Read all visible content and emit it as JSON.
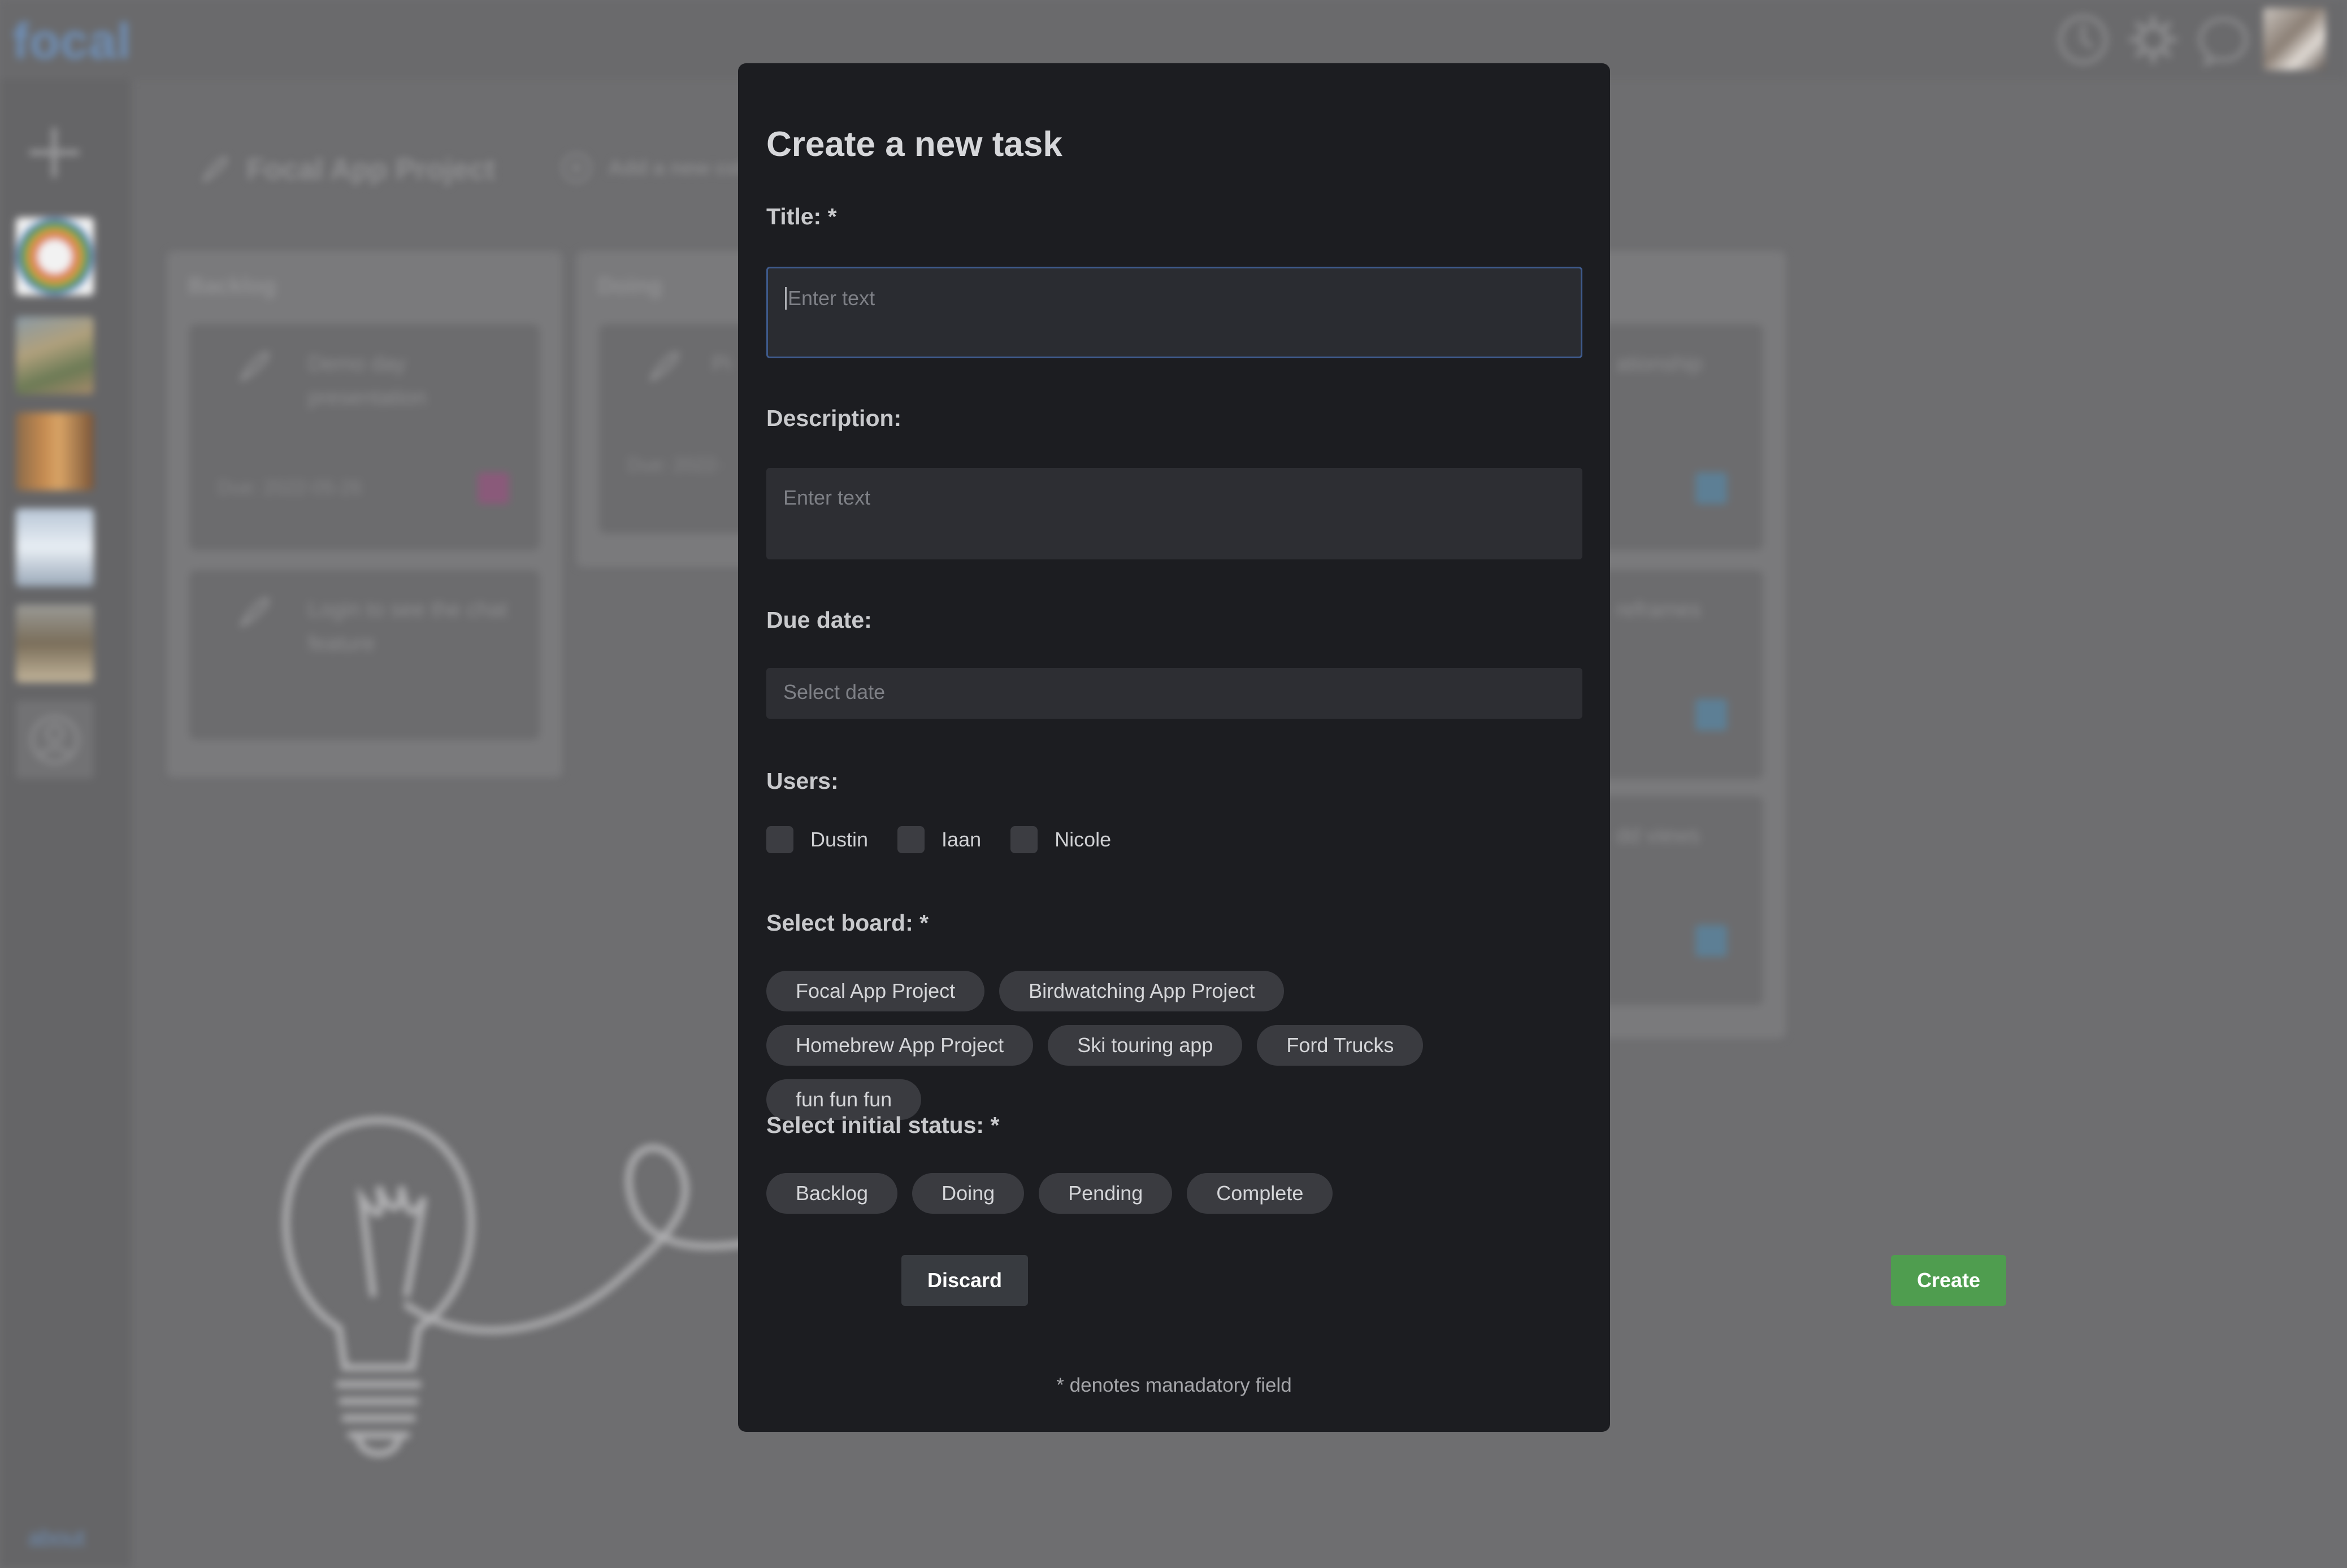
{
  "app": {
    "logo": "focal",
    "about_link": "about",
    "board_title": "Focal App Project",
    "add_column": "Add a new col",
    "columns": [
      {
        "title": "Backlog",
        "cards": [
          {
            "title": "Demo day presentation",
            "due": "Due: 2022-05-26"
          },
          {
            "title": "Login to see the chat feature",
            "due": ""
          }
        ]
      },
      {
        "title": "Doing",
        "cards": [
          {
            "title": "Pi",
            "due": "Due: 2022-"
          }
        ]
      },
      {
        "title": "",
        "cards": [
          {
            "title": "ationship",
            "due": ""
          },
          {
            "title": "reframes",
            "due": ""
          },
          {
            "title": "dd views",
            "due": ""
          }
        ]
      }
    ],
    "icons": {
      "top": [
        "clock-icon",
        "gear-icon",
        "chat-bubble-icon"
      ],
      "sidebar_add": "plus-icon",
      "sidebar_profile": "user-circle-icon"
    }
  },
  "modal": {
    "title": "Create a new task",
    "title_label": "Title: *",
    "title_placeholder": "Enter text",
    "description_label": "Description:",
    "description_placeholder": "Enter text",
    "due_label": "Due date:",
    "due_placeholder": "Select date",
    "users_label": "Users:",
    "users": [
      "Dustin",
      "Iaan",
      "Nicole"
    ],
    "board_label": "Select board: *",
    "boards": [
      "Focal App Project",
      "Birdwatching App Project",
      "Homebrew App Project",
      "Ski touring app",
      "Ford Trucks",
      "fun fun fun"
    ],
    "status_label": "Select initial status: *",
    "statuses": [
      "Backlog",
      "Doing",
      "Pending",
      "Complete"
    ],
    "discard_label": "Discard",
    "create_label": "Create",
    "footnote": "* denotes manadatory field"
  },
  "colors": {
    "modal_bg": "#1c1d21",
    "field_bg": "#2d2e33",
    "chip_bg": "#3a3b40",
    "create_green": "#4f9d4f",
    "discard_bg": "#383b40",
    "focus_border": "#3e5a8c",
    "logo_blue": "#6f8fb6"
  }
}
